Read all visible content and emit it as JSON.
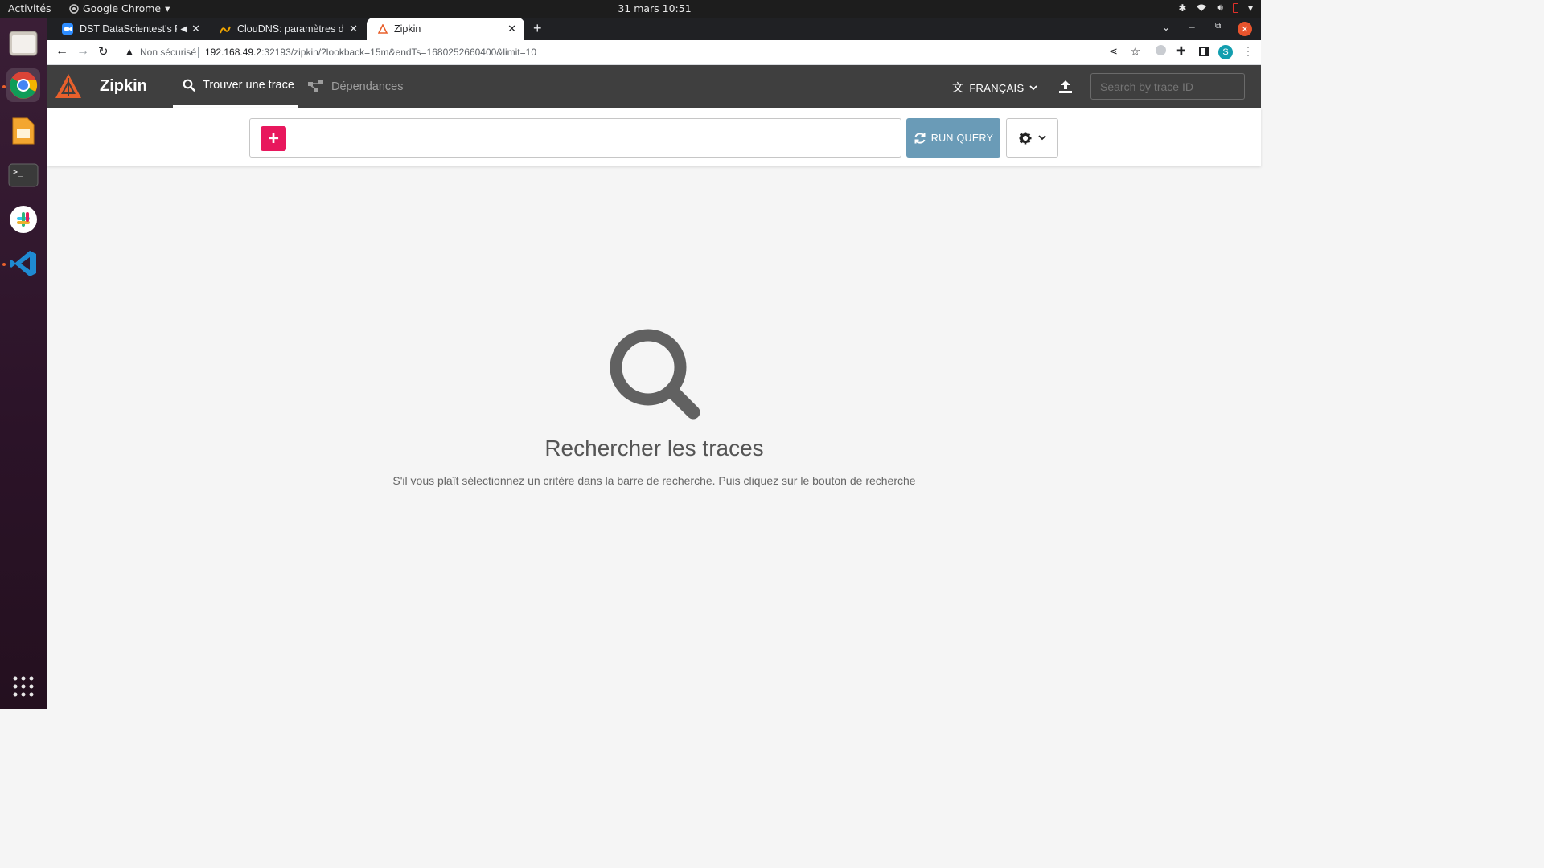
{
  "system": {
    "activities": "Activités",
    "app_menu": "Google Chrome",
    "clock": "31 mars  10:51"
  },
  "browser": {
    "tabs": [
      {
        "title": "DST DataScientest's P",
        "icon": "zoom-icon"
      },
      {
        "title": "ClouDNS: paramètres de",
        "icon": "cloudns-icon"
      },
      {
        "title": "Zipkin",
        "icon": "zipkin-icon"
      }
    ],
    "security_label": "Non sécurisé",
    "url_host": "192.168.49.2",
    "url_rest": ":32193/zipkin/?lookback=15m&endTs=1680252660400&limit=10",
    "profile_initial": "S"
  },
  "zipkin": {
    "brand": "Zipkin",
    "nav": {
      "find_trace": "Trouver une trace",
      "dependencies": "Dépendances"
    },
    "language": "FRANÇAIS",
    "trace_search_placeholder": "Search by trace ID",
    "add_button": "+",
    "run_query": "RUN QUERY",
    "empty_title": "Rechercher les traces",
    "empty_subtitle": "S'il vous plaît sélectionnez un critère dans la barre de recherche. Puis cliquez sur le bouton de recherche"
  },
  "colors": {
    "header_bg": "#3f3f3f",
    "accent_pink": "#e8175d",
    "run_query_bg": "#6a9bb7",
    "zipkin_orange": "#e8602c"
  }
}
